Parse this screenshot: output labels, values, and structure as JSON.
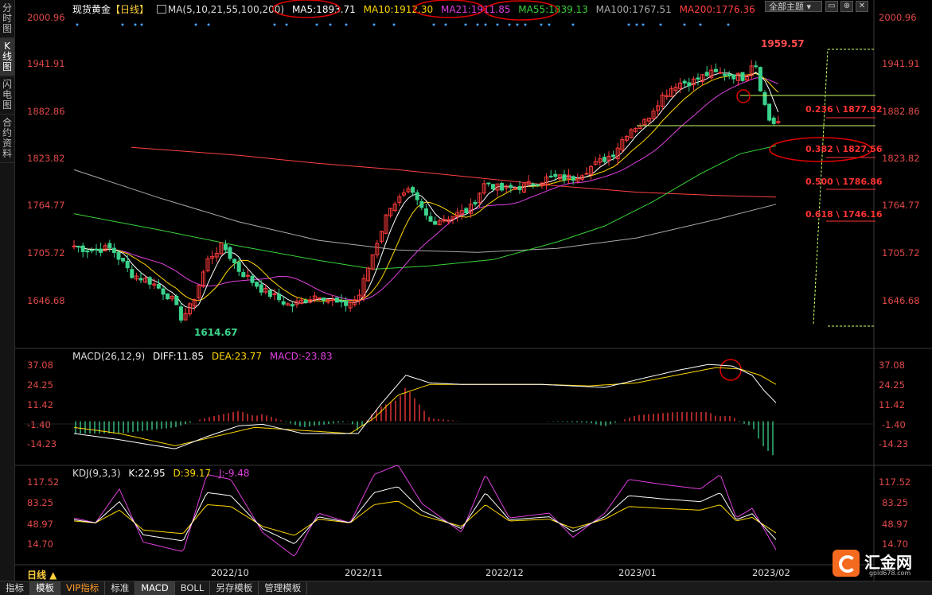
{
  "sidebar": {
    "items": [
      {
        "label": "分时图",
        "active": false
      },
      {
        "label": "K线图",
        "active": true
      },
      {
        "label": "闪电图",
        "active": false
      },
      {
        "label": "合约资料",
        "active": false
      }
    ]
  },
  "header": {
    "symbol": "现货黄金",
    "period_tag": "【日线】",
    "ma_params": "MA(5,10,21,55,100,200)",
    "ma5": "MA5:1893.71",
    "ma10": "MA10:1912.30",
    "ma21": "MA21:1911.85",
    "ma55": "MA55:1839.13",
    "ma100": "MA100:1767.51",
    "ma200": "MA200:1776.36",
    "dropdown": "全部主题"
  },
  "colors": {
    "ma5": "#ffffff",
    "ma10": "#ffd700",
    "ma21": "#e040e0",
    "ma55": "#39d339",
    "ma100": "#aaaaaa",
    "ma200": "#ff4040",
    "up": "#ff3b3b",
    "down": "#3bd38c",
    "axis": "#e04848",
    "annot": "#e00000",
    "fib": "#ccff66"
  },
  "price_axis": [
    "2000.96",
    "1941.91",
    "1882.86",
    "1823.82",
    "1764.77",
    "1705.72",
    "1646.68"
  ],
  "annotations": {
    "high": "1959.57",
    "low": "1614.67"
  },
  "fib_levels": [
    {
      "ratio": "0.236",
      "price": "1877.92"
    },
    {
      "ratio": "0.382",
      "price": "1827.56"
    },
    {
      "ratio": "0.500",
      "price": "1786.86"
    },
    {
      "ratio": "0.618",
      "price": "1746.16"
    }
  ],
  "macd": {
    "title": "MACD(26,12,9)",
    "diff": "DIFF:11.85",
    "dea": "DEA:23.77",
    "macd": "MACD:-23.83",
    "axis": [
      "37.08",
      "24.25",
      "11.42",
      "-1.40",
      "-14.23"
    ]
  },
  "kdj": {
    "title": "KDJ(9,3,3)",
    "k": "K:22.95",
    "d": "D:39.17",
    "j": "J:-9.48",
    "axis": [
      "117.52",
      "83.25",
      "48.97",
      "14.70"
    ]
  },
  "time_axis": [
    "2022/10",
    "2022/11",
    "2022/12",
    "2023/01",
    "2023/02"
  ],
  "period_label": "日线 ▲",
  "bottom_tabs": [
    {
      "label": "指标",
      "active": false,
      "vip": false
    },
    {
      "label": "模板",
      "active": true,
      "vip": false
    },
    {
      "label": "VIP指标",
      "active": false,
      "vip": true
    },
    {
      "label": "标准",
      "active": false,
      "vip": false
    },
    {
      "label": "MACD",
      "active": true,
      "vip": false
    },
    {
      "label": "BOLL",
      "active": false,
      "vip": false
    },
    {
      "label": "另存模板",
      "active": false,
      "vip": false
    },
    {
      "label": "管理模板",
      "active": false,
      "vip": false
    }
  ],
  "logo": {
    "text": "汇金网",
    "sub": "gold678.com"
  }
}
